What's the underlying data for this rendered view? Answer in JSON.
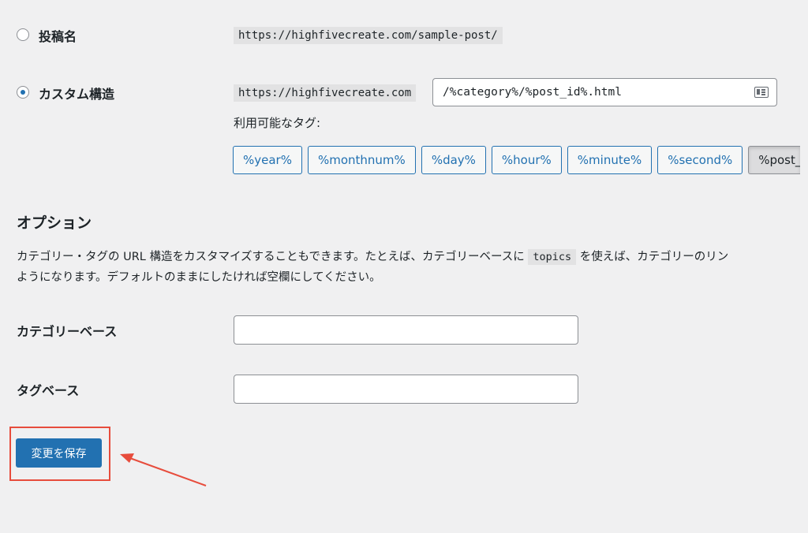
{
  "permalink_options": {
    "post_name": {
      "label": "投稿名",
      "example": "https://highfivecreate.com/sample-post/",
      "checked": false
    },
    "custom_structure": {
      "label": "カスタム構造",
      "base_url": "https://highfivecreate.com",
      "value": "/%category%/%post_id%.html",
      "checked": true
    }
  },
  "available_tags": {
    "label": "利用可能なタグ:",
    "tags": [
      "%year%",
      "%monthnum%",
      "%day%",
      "%hour%",
      "%minute%",
      "%second%",
      "%post_"
    ],
    "active_index": 6
  },
  "optional": {
    "heading": "オプション",
    "description_line1_before": "カテゴリー・タグの URL 構造をカスタマイズすることもできます。たとえば、カテゴリーベースに",
    "description_code": "topics",
    "description_line1_after": "を使えば、カテゴリーのリン",
    "description_line2": "ようになります。デフォルトのままにしたければ空欄にしてください。",
    "category_base": {
      "label": "カテゴリーベース",
      "value": ""
    },
    "tag_base": {
      "label": "タグベース",
      "value": ""
    }
  },
  "actions": {
    "save_label": "変更を保存"
  },
  "colors": {
    "accent": "#2271b1",
    "background": "#f0f0f1",
    "annotation_red": "#e74c3c"
  }
}
